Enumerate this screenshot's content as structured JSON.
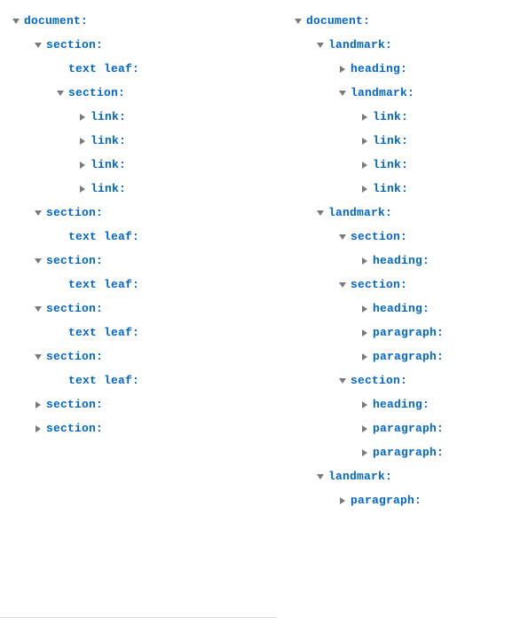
{
  "trees": {
    "left": {
      "expanded": true,
      "label": "document",
      "children": [
        {
          "expanded": true,
          "label": "section",
          "children": [
            {
              "expanded": null,
              "label": "text leaf"
            },
            {
              "expanded": true,
              "label": "section",
              "children": [
                {
                  "expanded": false,
                  "label": "link"
                },
                {
                  "expanded": false,
                  "label": "link"
                },
                {
                  "expanded": false,
                  "label": "link"
                },
                {
                  "expanded": false,
                  "label": "link"
                }
              ]
            }
          ]
        },
        {
          "expanded": true,
          "label": "section",
          "children": [
            {
              "expanded": null,
              "label": "text leaf"
            }
          ]
        },
        {
          "expanded": true,
          "label": "section",
          "children": [
            {
              "expanded": null,
              "label": "text leaf"
            }
          ]
        },
        {
          "expanded": true,
          "label": "section",
          "children": [
            {
              "expanded": null,
              "label": "text leaf"
            }
          ]
        },
        {
          "expanded": true,
          "label": "section",
          "children": [
            {
              "expanded": null,
              "label": "text leaf"
            }
          ]
        },
        {
          "expanded": false,
          "label": "section"
        },
        {
          "expanded": false,
          "label": "section"
        }
      ]
    },
    "right": {
      "expanded": true,
      "label": "document",
      "children": [
        {
          "expanded": true,
          "label": "landmark",
          "children": [
            {
              "expanded": false,
              "label": "heading"
            },
            {
              "expanded": true,
              "label": "landmark",
              "children": [
                {
                  "expanded": false,
                  "label": "link"
                },
                {
                  "expanded": false,
                  "label": "link"
                },
                {
                  "expanded": false,
                  "label": "link"
                },
                {
                  "expanded": false,
                  "label": "link"
                }
              ]
            }
          ]
        },
        {
          "expanded": true,
          "label": "landmark",
          "children": [
            {
              "expanded": true,
              "label": "section",
              "children": [
                {
                  "expanded": false,
                  "label": "heading"
                }
              ]
            },
            {
              "expanded": true,
              "label": "section",
              "children": [
                {
                  "expanded": false,
                  "label": "heading"
                },
                {
                  "expanded": false,
                  "label": "paragraph"
                },
                {
                  "expanded": false,
                  "label": "paragraph"
                }
              ]
            },
            {
              "expanded": true,
              "label": "section",
              "children": [
                {
                  "expanded": false,
                  "label": "heading"
                },
                {
                  "expanded": false,
                  "label": "paragraph"
                },
                {
                  "expanded": false,
                  "label": "paragraph"
                }
              ]
            }
          ]
        },
        {
          "expanded": true,
          "label": "landmark",
          "children": [
            {
              "expanded": false,
              "label": "paragraph"
            }
          ]
        }
      ]
    }
  }
}
